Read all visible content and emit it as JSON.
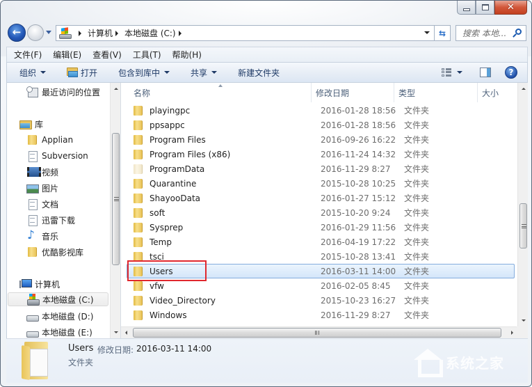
{
  "window": {
    "caption_buttons": {
      "minimize": "minimize-icon",
      "maximize": "maximize-icon",
      "close": "✕"
    }
  },
  "navigation": {
    "back_icon": "←",
    "refresh_icon": "⇆",
    "breadcrumb": [
      "计算机",
      "本地磁盘 (C:)"
    ],
    "search_placeholder": "搜索 本地..."
  },
  "menubar": {
    "items": [
      "文件(F)",
      "编辑(E)",
      "查看(V)",
      "工具(T)",
      "帮助(H)"
    ]
  },
  "toolbar": {
    "organize": "组织",
    "open": "打开",
    "include_in_library": "包含到库中",
    "share": "共享",
    "new_folder": "新建文件夹",
    "help": "?"
  },
  "sidebar": {
    "recent": "最近访问的位置",
    "libraries": {
      "label": "库",
      "items": [
        {
          "label": "Applian",
          "icon": "folder-icon"
        },
        {
          "label": "Subversion",
          "icon": "document-icon"
        },
        {
          "label": "视频",
          "icon": "video-icon"
        },
        {
          "label": "图片",
          "icon": "picture-icon"
        },
        {
          "label": "文档",
          "icon": "document-icon"
        },
        {
          "label": "迅雷下载",
          "icon": "document-icon"
        },
        {
          "label": "音乐",
          "icon": "music-icon"
        },
        {
          "label": "优酷影视库",
          "icon": "folder-icon"
        }
      ]
    },
    "computer": {
      "label": "计算机",
      "drives": [
        {
          "label": "本地磁盘 (C:)",
          "selected": true
        },
        {
          "label": "本地磁盘 (D:)",
          "selected": false
        },
        {
          "label": "本地磁盘 (E:)",
          "selected": false
        }
      ]
    }
  },
  "filelist": {
    "columns": [
      "名称",
      "修改日期",
      "类型",
      "大小"
    ],
    "rows": [
      {
        "name": "playingpc",
        "date": "2016-01-28 18:56",
        "type": "文件夹"
      },
      {
        "name": "ppsappc",
        "date": "2016-01-28 18:56",
        "type": "文件夹"
      },
      {
        "name": "Program Files",
        "date": "2016-09-26 16:22",
        "type": "文件夹"
      },
      {
        "name": "Program Files (x86)",
        "date": "2016-11-24 14:32",
        "type": "文件夹"
      },
      {
        "name": "ProgramData",
        "date": "2016-11-29 8:27",
        "type": "文件夹",
        "hidden": true
      },
      {
        "name": "Quarantine",
        "date": "2015-10-28 10:25",
        "type": "文件夹"
      },
      {
        "name": "ShayooData",
        "date": "2016-01-27 15:12",
        "type": "文件夹"
      },
      {
        "name": "soft",
        "date": "2015-10-20 9:24",
        "type": "文件夹"
      },
      {
        "name": "Sysprep",
        "date": "2016-01-29 11:56",
        "type": "文件夹"
      },
      {
        "name": "Temp",
        "date": "2016-04-19 17:22",
        "type": "文件夹"
      },
      {
        "name": "tsci",
        "date": "2015-10-28 13:41",
        "type": "文件夹"
      },
      {
        "name": "Users",
        "date": "2016-03-11 14:00",
        "type": "文件夹",
        "selected": true
      },
      {
        "name": "vfw",
        "date": "2016-02-05 8:45",
        "type": "文件夹"
      },
      {
        "name": "Video_Directory",
        "date": "2015-10-23 16:27",
        "type": "文件夹"
      },
      {
        "name": "Windows",
        "date": "2016-11-29 8:27",
        "type": "文件夹"
      }
    ]
  },
  "details": {
    "name": "Users",
    "date_label": "修改日期:",
    "date": "2016-03-11 14:00",
    "type": "文件夹"
  },
  "watermark": {
    "text": "系统之家"
  },
  "colors": {
    "highlight_box": "#e0282e",
    "selection": "#d4e6fa",
    "selection_border": "#84acdd"
  }
}
